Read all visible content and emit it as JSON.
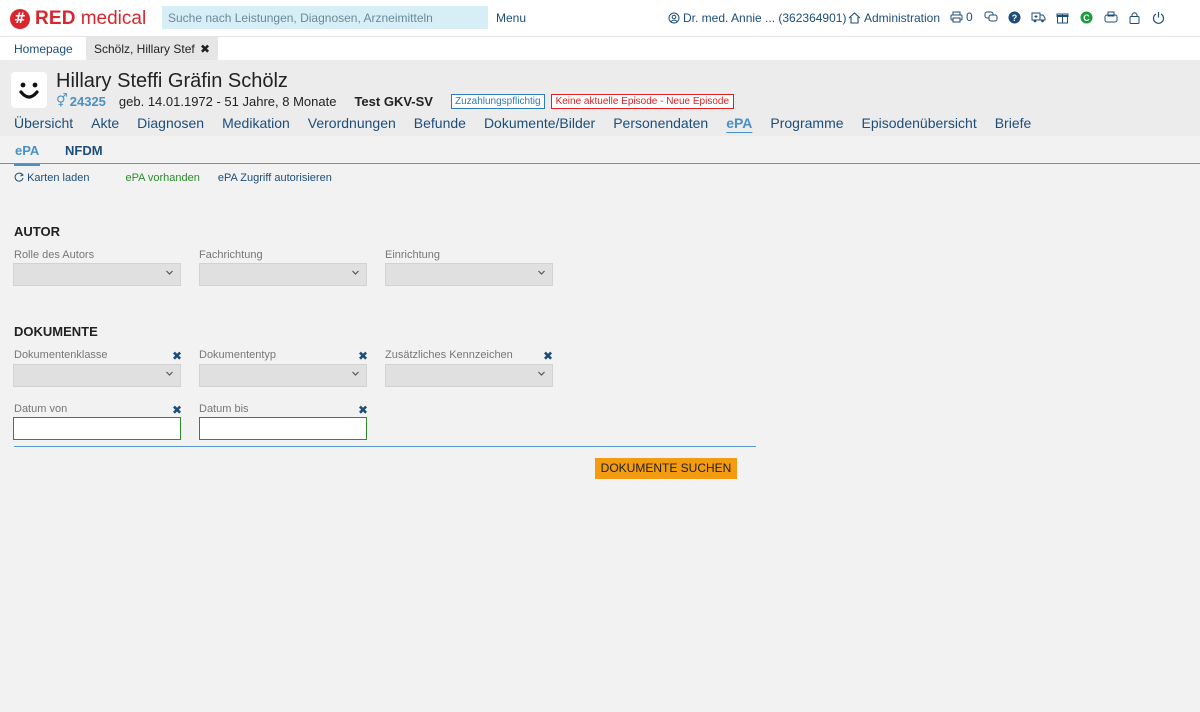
{
  "app": {
    "logo_symbol": "#",
    "logo_red": "RED",
    "logo_medical": "medical",
    "search_placeholder": "Suche nach Leistungen, Diagnosen, Arzneimitteln",
    "menu_label": "Menu",
    "user_label": "Dr. med. Annie ... (362364901)",
    "admin_label": "Administration",
    "print_count": "0",
    "brand_color": "#d9262e"
  },
  "tabs": {
    "home_label": "Homepage",
    "patient_tab_label": "Schölz, Hillary Stef",
    "close_glyph": "✖"
  },
  "patient": {
    "name": "Hillary Steffi Gräfin Schölz",
    "gender_glyph": "⚥",
    "id": "24325",
    "birth": "geb. 14.01.1972 - 51 Jahre, 8 Monate",
    "insurance": "Test GKV-SV",
    "badge_copay": "Zuzahlungspflichtig",
    "badge_episode": "Keine aktuelle Episode - Neue Episode"
  },
  "nav": {
    "items": [
      "Übersicht",
      "Akte",
      "Diagnosen",
      "Medikation",
      "Verordnungen",
      "Befunde",
      "Dokumente/Bilder",
      "Personendaten",
      "ePA",
      "Programme",
      "Episodenübersicht",
      "Briefe"
    ],
    "active": "ePA"
  },
  "subtabs": {
    "epa": "ePA",
    "nfdm": "NFDM"
  },
  "actions": {
    "load_cards": "Karten laden",
    "epa_available": "ePA vorhanden",
    "authorize": "ePA Zugriff autorisieren"
  },
  "autor": {
    "title": "AUTOR",
    "role_label": "Rolle des Autors",
    "specialty_label": "Fachrichtung",
    "institution_label": "Einrichtung"
  },
  "dokumente": {
    "title": "DOKUMENTE",
    "class_label": "Dokumentenklasse",
    "type_label": "Dokumententyp",
    "extra_label": "Zusätzliches Kennzeichen",
    "date_from_label": "Datum von",
    "date_to_label": "Datum bis",
    "clear_glyph": "✖",
    "search_button": "DOKUMENTE SUCHEN"
  }
}
